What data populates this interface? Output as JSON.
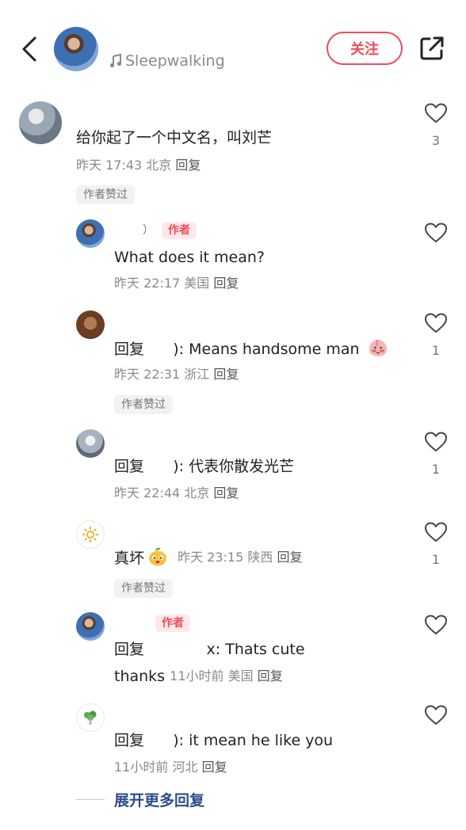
{
  "header": {
    "username": "",
    "music_icon": "music-note-icon",
    "music_title": "Sleepwalking",
    "follow_label": "关注",
    "accent_color": "#f04c5a"
  },
  "comments": [
    {
      "text": "给你起了一个中文名，叫刘芒",
      "time": "昨天 17:43",
      "location": "北京",
      "reply_label": "回复",
      "liked_badge": "作者赞过",
      "like_count": "3"
    },
    {
      "author_name_end": "）",
      "author_tag": "作者",
      "text": "What does it mean?",
      "time": "昨天 22:17",
      "location": "美国",
      "reply_label": "回复",
      "like_count": ""
    },
    {
      "reply_prefix": "回复",
      "text_suffix": "): Means handsome man",
      "emoji": "blushing-peach-emoji",
      "time": "昨天 22:31",
      "location": "浙江",
      "reply_label": "回复",
      "liked_badge": "作者赞过",
      "like_count": "1"
    },
    {
      "reply_prefix": "回复",
      "text_suffix": "): 代表你散发光芒",
      "time": "昨天 22:44",
      "location": "北京",
      "reply_label": "回复",
      "like_count": "1"
    },
    {
      "text": "真坏",
      "emoji": "mango-face-emoji",
      "time": "昨天 23:15",
      "location": "陕西",
      "reply_label": "回复",
      "liked_badge": "作者赞过",
      "like_count": "1"
    },
    {
      "author_tag": "作者",
      "reply_prefix": "回复",
      "text_suffix": "x: Thats cute",
      "text_line2": "thanks",
      "time": "11小时前",
      "location": "美国",
      "reply_label": "回复",
      "like_count": ""
    },
    {
      "reply_prefix": "回复",
      "text_suffix": "): it mean he like you",
      "time": "11小时前",
      "location": "河北",
      "reply_label": "回复",
      "like_count": ""
    }
  ],
  "expand_label": "展开更多回复"
}
